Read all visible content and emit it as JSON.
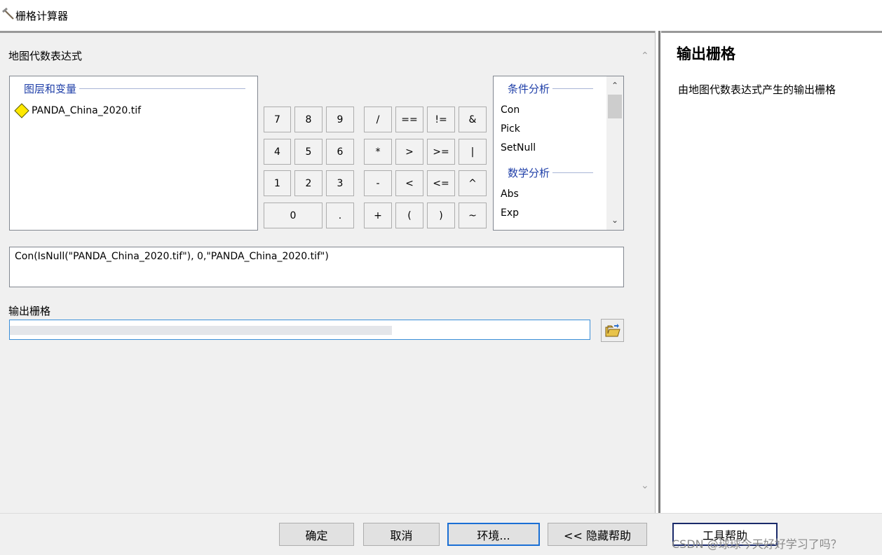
{
  "window": {
    "title": "栅格计算器"
  },
  "expression_section": {
    "label": "地图代数表达式"
  },
  "layers": {
    "header": "图层和变量",
    "items": [
      "PANDA_China_2020.tif"
    ]
  },
  "keypad": {
    "numbers": [
      "7",
      "8",
      "9",
      "4",
      "5",
      "6",
      "1",
      "2",
      "3",
      "0",
      "."
    ],
    "operators": [
      "/",
      "==",
      "!=",
      "&",
      "*",
      ">",
      ">=",
      "|",
      "-",
      "<",
      "<=",
      "^",
      "+",
      "(",
      ")",
      "~"
    ]
  },
  "functions": {
    "groups": [
      {
        "header": "条件分析",
        "items": [
          "Con",
          "Pick",
          "SetNull"
        ]
      },
      {
        "header": "数学分析",
        "items": [
          "Abs",
          "Exp"
        ]
      }
    ]
  },
  "expression": {
    "value": "Con(IsNull(\"PANDA_China_2020.tif\"), 0,\"PANDA_China_2020.tif\")"
  },
  "output": {
    "label": "输出栅格",
    "value": ""
  },
  "help_panel": {
    "title": "输出栅格",
    "description": "由地图代数表达式产生的输出栅格"
  },
  "buttons": {
    "ok": "确定",
    "cancel": "取消",
    "environments": "环境...",
    "hide_help": "<< 隐藏帮助",
    "tool_help": "工具帮助"
  },
  "watermark": "CSDN @球球今天好好学习了吗？",
  "colors": {
    "group_header": "#1f3fa8",
    "focus_border": "#1a6fd4",
    "diamond_fill": "#ffe800"
  }
}
